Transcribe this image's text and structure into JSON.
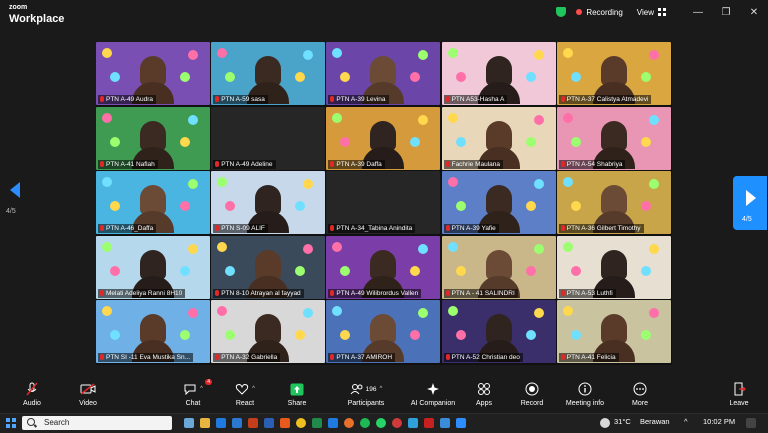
{
  "app": {
    "logo_line1": "zoom",
    "logo_line2": "Workplace"
  },
  "header": {
    "recording_label": "Recording",
    "view_label": "View"
  },
  "window_controls": {
    "minimize": "—",
    "restore": "❐",
    "close": "✕"
  },
  "navigation": {
    "left_page": "4/5",
    "right_page": "4/5"
  },
  "participants": [
    {
      "name": "PTN A-49 Audra",
      "bg": "#7a4fb3"
    },
    {
      "name": "PTN A-59 sasa",
      "bg": "#4aa3c9"
    },
    {
      "name": "PTN A-39 Levina",
      "bg": "#6b46a8"
    },
    {
      "name": "PTN A53-Hasha A",
      "bg": "#f0c8d8"
    },
    {
      "name": "PTN A-37 Calistya Atmadevi",
      "bg": "#d9a640"
    },
    {
      "name": "PTN A-41 Naflah",
      "bg": "#3f9a52"
    },
    {
      "name": "PTN A-49 Adeline",
      "bg": "#262626"
    },
    {
      "name": "PTN A-39 Daffa",
      "bg": "#d59a3c"
    },
    {
      "name": "Fachrie Maulana",
      "bg": "#e9d7b9"
    },
    {
      "name": "PTN A-54 Shabriya",
      "bg": "#e896b4"
    },
    {
      "name": "PTN A-46_Daffa",
      "bg": "#49b5e0"
    },
    {
      "name": "PTN S-09 ALIF",
      "bg": "#c7d8ea"
    },
    {
      "name": "PTN A-34_Tabina Anindita",
      "bg": "#262626"
    },
    {
      "name": "PTN A-39 Yafie",
      "bg": "#5d7fc8"
    },
    {
      "name": "PTN A-36 Gilbert Timothy",
      "bg": "#c8a548"
    },
    {
      "name": "Melati Adeliya Ranni 8H10",
      "bg": "#b6d8ec"
    },
    {
      "name": "PTN 8-10 Atrayan al fayyad",
      "bg": "#3a4a5a"
    },
    {
      "name": "PTN A-49 Wilibrordus Vallen",
      "bg": "#7b3ea8"
    },
    {
      "name": "PTN A - 41 SALINDRI",
      "bg": "#c9b78a"
    },
    {
      "name": "PTN A-53 Luthfi",
      "bg": "#e6dfd2"
    },
    {
      "name": "PTN SI -11 Eva Mustika Sn...",
      "bg": "#6fb0e6"
    },
    {
      "name": "PTN A-32 Gabriella",
      "bg": "#d8d8d8"
    },
    {
      "name": "PTN A-37 AMIROH",
      "bg": "#4b72b8"
    },
    {
      "name": "PTN A-52 Christian deo",
      "bg": "#3a2f6a"
    },
    {
      "name": "PTN A-41 Felicia",
      "bg": "#c9c3a0"
    }
  ],
  "toolbar": {
    "audio": "Audio",
    "video": "Video",
    "chat": "Chat",
    "chat_badge": "4",
    "react": "React",
    "share": "Share",
    "participants": "Participants",
    "participants_count": "196",
    "ai_companion": "AI Companion",
    "apps": "Apps",
    "record": "Record",
    "meeting_info": "Meeting info",
    "more": "More",
    "leave": "Leave"
  },
  "taskbar": {
    "search_placeholder": "Search",
    "weather": "31°C",
    "weather_desc": "Berawan",
    "time": "10:02 PM"
  },
  "colors": {
    "accent": "#1e90ff",
    "recording": "#ff4d4d",
    "share": "#21c55d",
    "leave": "#e02828"
  }
}
